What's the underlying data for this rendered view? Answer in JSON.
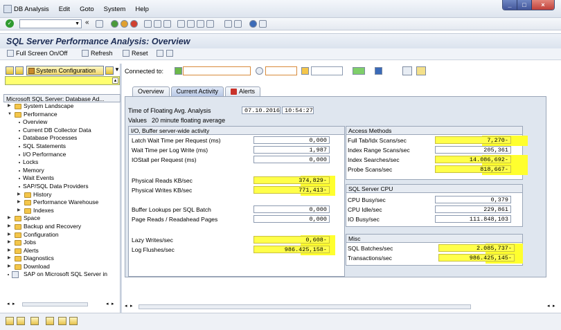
{
  "menu": [
    "DB Analysis",
    "Edit",
    "Goto",
    "System",
    "Help"
  ],
  "window_controls": [
    "_",
    "□",
    "×"
  ],
  "title": "SQL Server Performance Analysis: Overview",
  "app_toolbar": {
    "fullscreen": "Full Screen On/Off",
    "refresh": "Refresh",
    "reset": "Reset"
  },
  "left": {
    "system_config_label": "System Configuration",
    "tree_root": "Microsoft SQL Server: Database Ad...",
    "items": [
      {
        "label": "System Landscape",
        "type": "folder",
        "level": 0,
        "expanded": false
      },
      {
        "label": "Performance",
        "type": "folder",
        "level": 0,
        "expanded": true
      },
      {
        "label": "Overview",
        "type": "leaf",
        "level": 1
      },
      {
        "label": "Current DB Collector Data",
        "type": "leaf",
        "level": 1
      },
      {
        "label": "Database Processes",
        "type": "leaf",
        "level": 1
      },
      {
        "label": "SQL Statements",
        "type": "leaf",
        "level": 1
      },
      {
        "label": "I/O Performance",
        "type": "leaf",
        "level": 1
      },
      {
        "label": "Locks",
        "type": "leaf",
        "level": 1
      },
      {
        "label": "Memory",
        "type": "leaf",
        "level": 1
      },
      {
        "label": "Wait Events",
        "type": "leaf",
        "level": 1
      },
      {
        "label": "SAP/SQL Data Providers",
        "type": "leaf",
        "level": 1
      },
      {
        "label": "History",
        "type": "folder",
        "level": 1,
        "expanded": false
      },
      {
        "label": "Performance Warehouse",
        "type": "folder",
        "level": 1,
        "expanded": false
      },
      {
        "label": "Indexes",
        "type": "folder",
        "level": 1,
        "expanded": false
      },
      {
        "label": "Space",
        "type": "folder",
        "level": 0,
        "expanded": false
      },
      {
        "label": "Backup and Recovery",
        "type": "folder",
        "level": 0,
        "expanded": false
      },
      {
        "label": "Configuration",
        "type": "folder",
        "level": 0,
        "expanded": false
      },
      {
        "label": "Jobs",
        "type": "folder",
        "level": 0,
        "expanded": false
      },
      {
        "label": "Alerts",
        "type": "folder",
        "level": 0,
        "expanded": false
      },
      {
        "label": "Diagnostics",
        "type": "folder",
        "level": 0,
        "expanded": false
      },
      {
        "label": "Download",
        "type": "folder",
        "level": 0,
        "expanded": false
      },
      {
        "label": "SAP on Microsoft SQL Server in",
        "type": "sap",
        "level": 0
      }
    ]
  },
  "connected_label": "Connected to:",
  "tabs": [
    "Overview",
    "Current Activity",
    "Alerts"
  ],
  "active_tab": "Current Activity",
  "floating": {
    "time_label": "Time of Floating Avg. Analysis",
    "date": "07.10.2016",
    "time": "10:54:27",
    "values_label": "Values",
    "values_text": "20 minute floating average"
  },
  "io_group": {
    "title": "I/O, Buffer server-wide activity",
    "rows": [
      {
        "label": "Latch Wait Time per Request (ms)",
        "value": "0,000",
        "hl": false
      },
      {
        "label": "Wait Time per Log Write (ms)",
        "value": "1,987",
        "hl": false
      },
      {
        "label": "IOStall per Request (ms)",
        "value": "0,000",
        "hl": false
      },
      {
        "label": "Physical Reads KB/sec",
        "value": "374,829-",
        "hl": true
      },
      {
        "label": "Physical Writes KB/sec",
        "value": "771,413-",
        "hl": true
      },
      {
        "label": "Buffer Lookups per SQL Batch",
        "value": "0,000",
        "hl": false
      },
      {
        "label": "Page Reads / Readahead Pages",
        "value": "0,000",
        "hl": false
      },
      {
        "label": "Lazy Writes/sec",
        "value": "0,608-",
        "hl": true
      },
      {
        "label": "Log Flushes/sec",
        "value": "986.425,158-",
        "hl": true
      }
    ]
  },
  "access_group": {
    "title": "Access Methods",
    "rows": [
      {
        "label": "Full Tab/Idx Scans/sec",
        "value": "7,270-",
        "hl": true
      },
      {
        "label": "Index Range Scans/sec",
        "value": "205,361",
        "hl": false
      },
      {
        "label": "Index Searches/sec",
        "value": "14.086,692-",
        "hl": true
      },
      {
        "label": "Probe Scans/sec",
        "value": "818,667-",
        "hl": true
      }
    ]
  },
  "cpu_group": {
    "title": "SQL Server CPU",
    "rows": [
      {
        "label": "CPU Busy/sec",
        "value": "0,379",
        "hl": false
      },
      {
        "label": "CPU Idle/sec",
        "value": "229,861",
        "hl": false
      },
      {
        "label": "IO Busy/sec",
        "value": "111.848,103",
        "hl": false
      }
    ]
  },
  "misc_group": {
    "title": "Misc",
    "rows": [
      {
        "label": "SQL Batches/sec",
        "value": "2.085,737-",
        "hl": true
      },
      {
        "label": "Transactions/sec",
        "value": "986.425,145-",
        "hl": true
      }
    ]
  },
  "colors": {
    "highlight": "#ffff2e",
    "title_text": "#1d2d55",
    "panel_bg": "#dfe6ef"
  }
}
